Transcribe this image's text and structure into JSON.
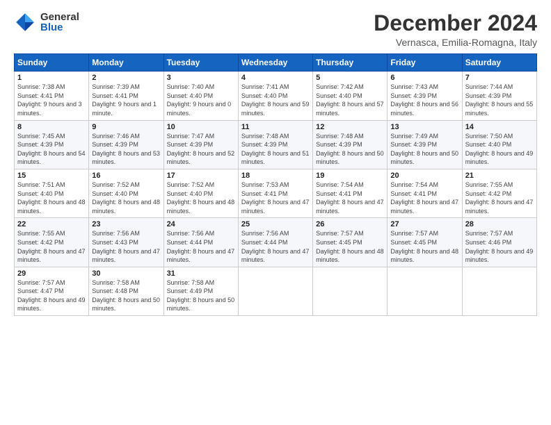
{
  "logo": {
    "general": "General",
    "blue": "Blue"
  },
  "title": "December 2024",
  "subtitle": "Vernasca, Emilia-Romagna, Italy",
  "days_header": [
    "Sunday",
    "Monday",
    "Tuesday",
    "Wednesday",
    "Thursday",
    "Friday",
    "Saturday"
  ],
  "weeks": [
    [
      {
        "day": "1",
        "sunrise": "Sunrise: 7:38 AM",
        "sunset": "Sunset: 4:41 PM",
        "daylight": "Daylight: 9 hours and 3 minutes."
      },
      {
        "day": "2",
        "sunrise": "Sunrise: 7:39 AM",
        "sunset": "Sunset: 4:41 PM",
        "daylight": "Daylight: 9 hours and 1 minute."
      },
      {
        "day": "3",
        "sunrise": "Sunrise: 7:40 AM",
        "sunset": "Sunset: 4:40 PM",
        "daylight": "Daylight: 9 hours and 0 minutes."
      },
      {
        "day": "4",
        "sunrise": "Sunrise: 7:41 AM",
        "sunset": "Sunset: 4:40 PM",
        "daylight": "Daylight: 8 hours and 59 minutes."
      },
      {
        "day": "5",
        "sunrise": "Sunrise: 7:42 AM",
        "sunset": "Sunset: 4:40 PM",
        "daylight": "Daylight: 8 hours and 57 minutes."
      },
      {
        "day": "6",
        "sunrise": "Sunrise: 7:43 AM",
        "sunset": "Sunset: 4:39 PM",
        "daylight": "Daylight: 8 hours and 56 minutes."
      },
      {
        "day": "7",
        "sunrise": "Sunrise: 7:44 AM",
        "sunset": "Sunset: 4:39 PM",
        "daylight": "Daylight: 8 hours and 55 minutes."
      }
    ],
    [
      {
        "day": "8",
        "sunrise": "Sunrise: 7:45 AM",
        "sunset": "Sunset: 4:39 PM",
        "daylight": "Daylight: 8 hours and 54 minutes."
      },
      {
        "day": "9",
        "sunrise": "Sunrise: 7:46 AM",
        "sunset": "Sunset: 4:39 PM",
        "daylight": "Daylight: 8 hours and 53 minutes."
      },
      {
        "day": "10",
        "sunrise": "Sunrise: 7:47 AM",
        "sunset": "Sunset: 4:39 PM",
        "daylight": "Daylight: 8 hours and 52 minutes."
      },
      {
        "day": "11",
        "sunrise": "Sunrise: 7:48 AM",
        "sunset": "Sunset: 4:39 PM",
        "daylight": "Daylight: 8 hours and 51 minutes."
      },
      {
        "day": "12",
        "sunrise": "Sunrise: 7:48 AM",
        "sunset": "Sunset: 4:39 PM",
        "daylight": "Daylight: 8 hours and 50 minutes."
      },
      {
        "day": "13",
        "sunrise": "Sunrise: 7:49 AM",
        "sunset": "Sunset: 4:39 PM",
        "daylight": "Daylight: 8 hours and 50 minutes."
      },
      {
        "day": "14",
        "sunrise": "Sunrise: 7:50 AM",
        "sunset": "Sunset: 4:40 PM",
        "daylight": "Daylight: 8 hours and 49 minutes."
      }
    ],
    [
      {
        "day": "15",
        "sunrise": "Sunrise: 7:51 AM",
        "sunset": "Sunset: 4:40 PM",
        "daylight": "Daylight: 8 hours and 48 minutes."
      },
      {
        "day": "16",
        "sunrise": "Sunrise: 7:52 AM",
        "sunset": "Sunset: 4:40 PM",
        "daylight": "Daylight: 8 hours and 48 minutes."
      },
      {
        "day": "17",
        "sunrise": "Sunrise: 7:52 AM",
        "sunset": "Sunset: 4:40 PM",
        "daylight": "Daylight: 8 hours and 48 minutes."
      },
      {
        "day": "18",
        "sunrise": "Sunrise: 7:53 AM",
        "sunset": "Sunset: 4:41 PM",
        "daylight": "Daylight: 8 hours and 47 minutes."
      },
      {
        "day": "19",
        "sunrise": "Sunrise: 7:54 AM",
        "sunset": "Sunset: 4:41 PM",
        "daylight": "Daylight: 8 hours and 47 minutes."
      },
      {
        "day": "20",
        "sunrise": "Sunrise: 7:54 AM",
        "sunset": "Sunset: 4:41 PM",
        "daylight": "Daylight: 8 hours and 47 minutes."
      },
      {
        "day": "21",
        "sunrise": "Sunrise: 7:55 AM",
        "sunset": "Sunset: 4:42 PM",
        "daylight": "Daylight: 8 hours and 47 minutes."
      }
    ],
    [
      {
        "day": "22",
        "sunrise": "Sunrise: 7:55 AM",
        "sunset": "Sunset: 4:42 PM",
        "daylight": "Daylight: 8 hours and 47 minutes."
      },
      {
        "day": "23",
        "sunrise": "Sunrise: 7:56 AM",
        "sunset": "Sunset: 4:43 PM",
        "daylight": "Daylight: 8 hours and 47 minutes."
      },
      {
        "day": "24",
        "sunrise": "Sunrise: 7:56 AM",
        "sunset": "Sunset: 4:44 PM",
        "daylight": "Daylight: 8 hours and 47 minutes."
      },
      {
        "day": "25",
        "sunrise": "Sunrise: 7:56 AM",
        "sunset": "Sunset: 4:44 PM",
        "daylight": "Daylight: 8 hours and 47 minutes."
      },
      {
        "day": "26",
        "sunrise": "Sunrise: 7:57 AM",
        "sunset": "Sunset: 4:45 PM",
        "daylight": "Daylight: 8 hours and 48 minutes."
      },
      {
        "day": "27",
        "sunrise": "Sunrise: 7:57 AM",
        "sunset": "Sunset: 4:45 PM",
        "daylight": "Daylight: 8 hours and 48 minutes."
      },
      {
        "day": "28",
        "sunrise": "Sunrise: 7:57 AM",
        "sunset": "Sunset: 4:46 PM",
        "daylight": "Daylight: 8 hours and 49 minutes."
      }
    ],
    [
      {
        "day": "29",
        "sunrise": "Sunrise: 7:57 AM",
        "sunset": "Sunset: 4:47 PM",
        "daylight": "Daylight: 8 hours and 49 minutes."
      },
      {
        "day": "30",
        "sunrise": "Sunrise: 7:58 AM",
        "sunset": "Sunset: 4:48 PM",
        "daylight": "Daylight: 8 hours and 50 minutes."
      },
      {
        "day": "31",
        "sunrise": "Sunrise: 7:58 AM",
        "sunset": "Sunset: 4:49 PM",
        "daylight": "Daylight: 8 hours and 50 minutes."
      },
      null,
      null,
      null,
      null
    ]
  ]
}
